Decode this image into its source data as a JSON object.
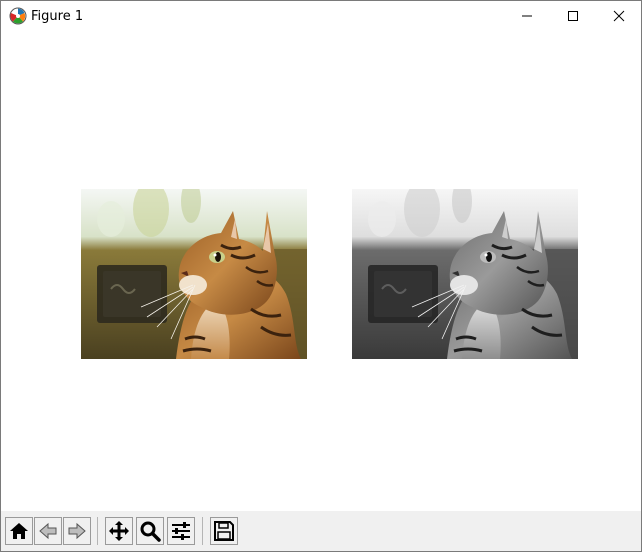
{
  "window": {
    "title": "Figure 1",
    "app_icon": "matplotlib-icon",
    "controls": [
      "minimize-icon",
      "maximize-icon",
      "close-icon"
    ]
  },
  "figure": {
    "panels": [
      {
        "name": "cat-photo-color",
        "mode": "color"
      },
      {
        "name": "cat-photo-grayscale",
        "mode": "grayscale"
      }
    ]
  },
  "toolbar": {
    "buttons": [
      {
        "name": "home-button",
        "icon": "home-icon"
      },
      {
        "name": "back-button",
        "icon": "arrow-left-icon"
      },
      {
        "name": "forward-button",
        "icon": "arrow-right-icon"
      },
      {
        "name": "pan-button",
        "icon": "move-icon"
      },
      {
        "name": "zoom-button",
        "icon": "magnifier-icon"
      },
      {
        "name": "subplots-button",
        "icon": "sliders-icon"
      },
      {
        "name": "save-button",
        "icon": "floppy-disk-icon"
      }
    ]
  },
  "colors": {
    "toolbar_bg": "#f0f0f0",
    "canvas_bg": "#ffffff",
    "fur_orange": "#b5722d",
    "background_olive": "#5e5226"
  }
}
